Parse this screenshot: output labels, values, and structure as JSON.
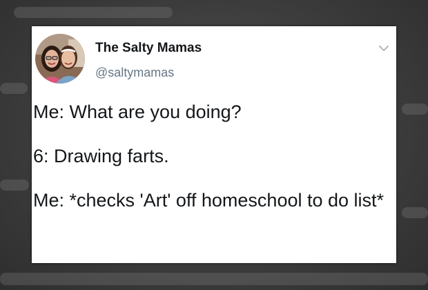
{
  "tweet": {
    "display_name": "The Salty Mamas",
    "handle": "@saltymamas",
    "text": "Me: What are you doing?\n\n6: Drawing farts.\n\nMe: *checks 'Art' off homeschool to do list*"
  },
  "icons": {
    "avatar": "avatar-photo",
    "menu": "chevron-down-icon"
  },
  "colors": {
    "background": "#3a3a3a",
    "card": "#ffffff",
    "name_text": "#14171a",
    "handle_text": "#657786",
    "chevron": "#aab8c2"
  }
}
